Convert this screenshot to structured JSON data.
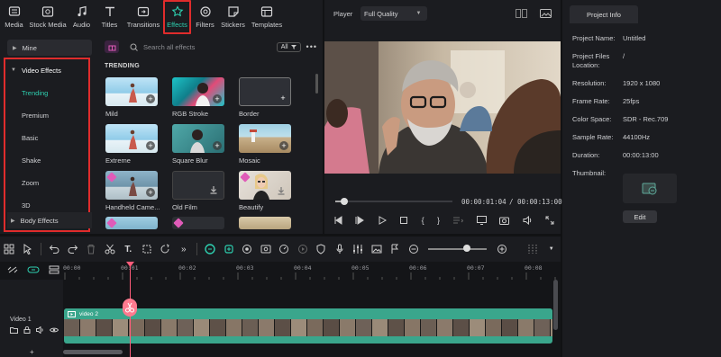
{
  "toolbar": {
    "items": [
      {
        "label": "Media",
        "icon": "media-icon"
      },
      {
        "label": "Stock Media",
        "icon": "stock-media-icon"
      },
      {
        "label": "Audio",
        "icon": "audio-icon"
      },
      {
        "label": "Titles",
        "icon": "titles-icon"
      },
      {
        "label": "Transitions",
        "icon": "transitions-icon"
      },
      {
        "label": "Effects",
        "icon": "effects-icon",
        "active": true
      },
      {
        "label": "Filters",
        "icon": "filters-icon"
      },
      {
        "label": "Stickers",
        "icon": "stickers-icon"
      },
      {
        "label": "Templates",
        "icon": "templates-icon"
      }
    ]
  },
  "categories": {
    "mine": "Mine",
    "video_effects": "Video Effects",
    "sub": [
      "Trending",
      "Premium",
      "Basic",
      "Shake",
      "Zoom",
      "3D"
    ],
    "active": "Trending",
    "body_effects": "Body Effects"
  },
  "browser": {
    "search_placeholder": "Search all effects",
    "filter_label": "All",
    "section": "TRENDING",
    "effects": [
      "Mild",
      "RGB Stroke",
      "Border",
      "Extreme",
      "Square Blur",
      "Mosaic",
      "Handheld Came...",
      "Old Film",
      "Beautify"
    ]
  },
  "player": {
    "label": "Player",
    "quality": "Full Quality",
    "current_time": "00:00:01:04",
    "separator": "/",
    "total_time": "00:00:13:00",
    "progress": 0.08
  },
  "project_info": {
    "tab": "Project Info",
    "rows": [
      {
        "k": "Project Name:",
        "v": "Untitled"
      },
      {
        "k": "Project Files Location:",
        "v": "/"
      },
      {
        "k": "Resolution:",
        "v": "1920 x 1080"
      },
      {
        "k": "Frame Rate:",
        "v": "25fps"
      },
      {
        "k": "Color Space:",
        "v": "SDR - Rec.709"
      },
      {
        "k": "Sample Rate:",
        "v": "44100Hz"
      },
      {
        "k": "Duration:",
        "v": "00:00:13:00"
      },
      {
        "k": "Thumbnail:",
        "v": ""
      }
    ],
    "edit": "Edit"
  },
  "timeline": {
    "ruler": [
      "00:00",
      "00:01",
      "00:02",
      "00:03",
      "00:04",
      "00:05",
      "00:06",
      "00:07",
      "00:08"
    ],
    "track": "Video 1",
    "clip": "video 2"
  },
  "colors": {
    "accent": "#2ed0b0",
    "highlight": "#e02c2c",
    "playhead": "#ff5c7a",
    "clip": "#3aa68c"
  }
}
